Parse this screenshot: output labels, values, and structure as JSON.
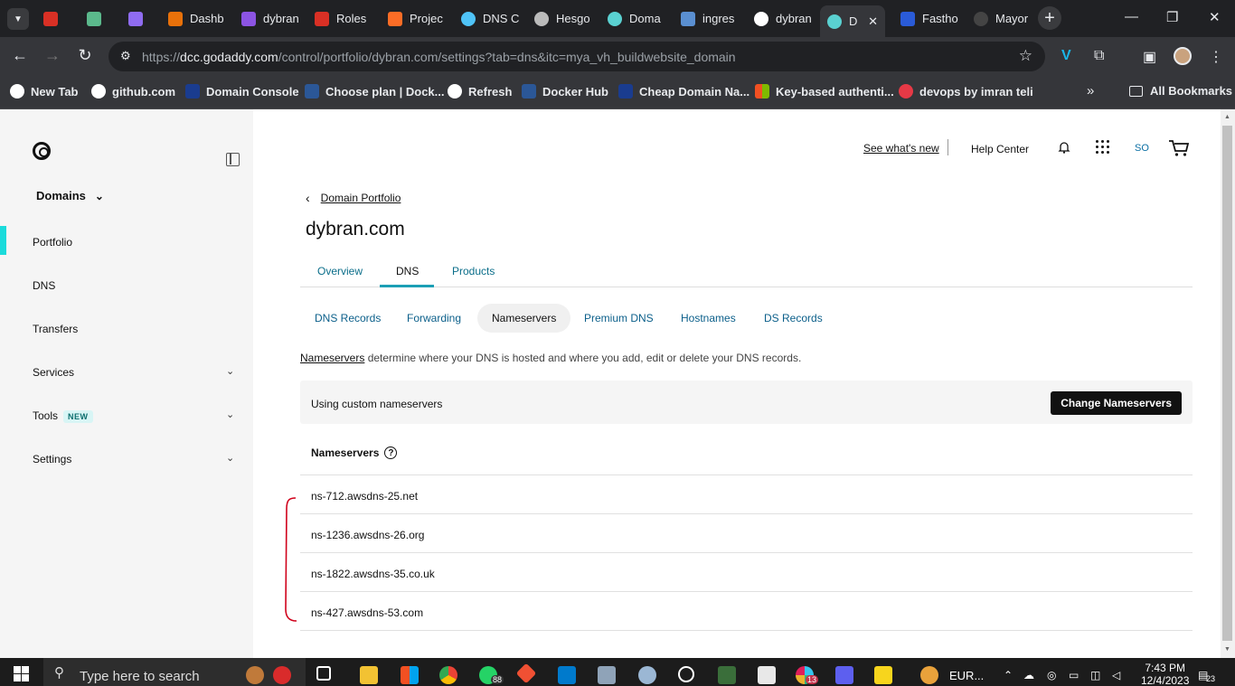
{
  "browser": {
    "tabs": [
      {
        "label": "",
        "color": "#d93025"
      },
      {
        "label": "",
        "color": "#5bb98c"
      },
      {
        "label": "",
        "color": "#8f6cf0"
      },
      {
        "label": "Dashb",
        "color": "#e8710a"
      },
      {
        "label": "dybran",
        "color": "#8c54e3"
      },
      {
        "label": "Roles",
        "color": "#d93025"
      },
      {
        "label": "Projec",
        "color": "#fc6d26"
      },
      {
        "label": "DNS C",
        "color": "#4fc3f7"
      },
      {
        "label": "Hesgo",
        "color": "#bbbbbb"
      },
      {
        "label": "Doma",
        "color": "#5ad1d1"
      },
      {
        "label": "ingres",
        "color": "#5a8fd1"
      },
      {
        "label": "dybran",
        "color": "#ffffff"
      },
      {
        "label": "D",
        "color": "#5ad1d1"
      },
      {
        "label": "Fastho",
        "color": "#2a5bd7"
      },
      {
        "label": "Mayor",
        "color": "#444444"
      }
    ],
    "active_tab_close": "✕",
    "url_host": "dcc.godaddy.com",
    "url_prefix": "https://",
    "url_path": "/control/portfolio/dybran.com/settings?tab=dns&itc=mya_vh_buildwebsite_domain",
    "bookmarks": [
      {
        "label": "New Tab",
        "color": "#ffffff"
      },
      {
        "label": "github.com",
        "color": "#ffffff"
      },
      {
        "label": "Domain Console",
        "color": "#1a3c8f"
      },
      {
        "label": "Choose plan | Dock...",
        "color": "#2b5797"
      },
      {
        "label": "Refresh",
        "color": "#ffffff"
      },
      {
        "label": "Docker Hub",
        "color": "#2b5797"
      },
      {
        "label": "Cheap Domain Na...",
        "color": "#1a3c8f"
      },
      {
        "label": "Key-based authenti...",
        "color": "#f25022"
      },
      {
        "label": "devops by imran teli",
        "color": "#e63946"
      }
    ],
    "all_bookmarks": "All Bookmarks",
    "more": "»"
  },
  "sidebar": {
    "product_menu": "Domains",
    "items": [
      {
        "label": "Portfolio",
        "active": true,
        "expandable": false,
        "badge": ""
      },
      {
        "label": "DNS",
        "active": false,
        "expandable": false,
        "badge": ""
      },
      {
        "label": "Transfers",
        "active": false,
        "expandable": false,
        "badge": ""
      },
      {
        "label": "Services",
        "active": false,
        "expandable": true,
        "badge": ""
      },
      {
        "label": "Tools",
        "active": false,
        "expandable": true,
        "badge": "NEW"
      },
      {
        "label": "Settings",
        "active": false,
        "expandable": true,
        "badge": ""
      }
    ]
  },
  "header": {
    "whats_new": "See what's new",
    "help_center": "Help Center",
    "user_initials": "SO"
  },
  "main": {
    "back_label": "Domain Portfolio",
    "domain": "dybran.com",
    "tabs": [
      "Overview",
      "DNS",
      "Products"
    ],
    "active_tab": "DNS",
    "subtabs": [
      "DNS Records",
      "Forwarding",
      "Nameservers",
      "Premium DNS",
      "Hostnames",
      "DS Records"
    ],
    "active_subtab": "Nameservers",
    "description_link": "Nameservers",
    "description_text": " determine where your DNS is hosted and where you add, edit or delete your DNS records.",
    "custom_label": "Using custom nameservers",
    "change_button": "Change Nameservers",
    "nameservers_header": "Nameservers",
    "nameservers": [
      "ns-712.awsdns-25.net",
      "ns-1236.awsdns-26.org",
      "ns-1822.awsdns-35.co.uk",
      "ns-427.awsdns-53.com"
    ]
  },
  "taskbar": {
    "search_placeholder": "Type here to search",
    "whatsapp_badge": "88",
    "slack_badge": "13",
    "weather": "EUR...",
    "time": "7:43 PM",
    "date": "12/4/2023",
    "notifications": "23"
  }
}
